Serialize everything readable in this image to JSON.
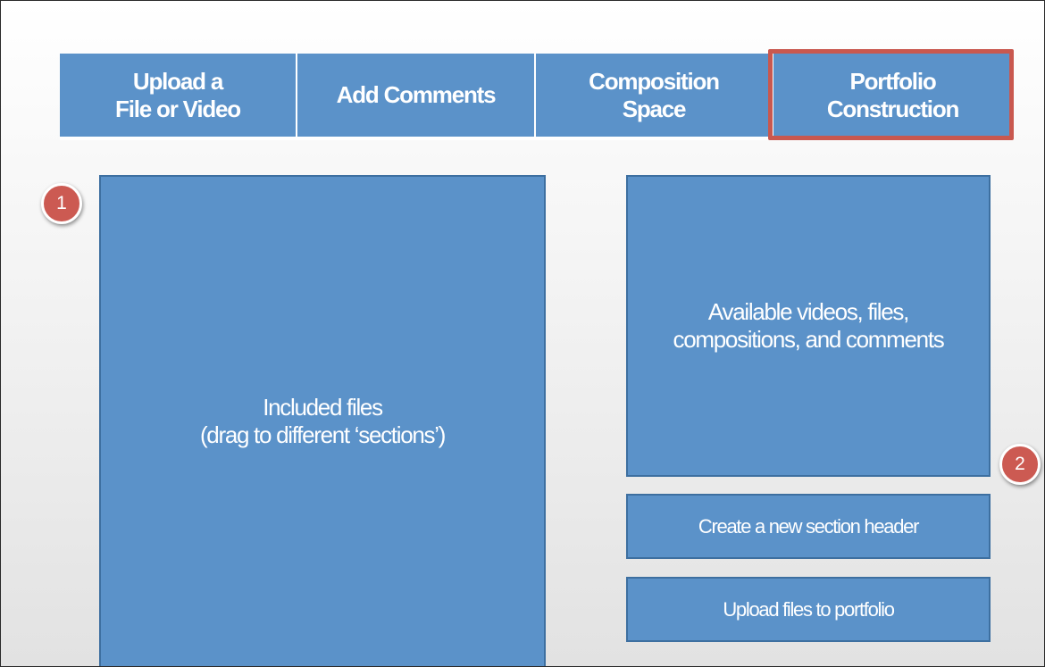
{
  "tabs": [
    {
      "label": "Upload  a\nFile or Video"
    },
    {
      "label": "Add Comments"
    },
    {
      "label": "Composition\nSpace"
    },
    {
      "label": "Portfolio\nConstruction"
    }
  ],
  "panels": {
    "included": "Included files\n(drag to different ‘sections’)",
    "available": "Available videos,  files,\ncompositions, and comments"
  },
  "buttons": {
    "create_section": "Create a new section header",
    "upload_files": "Upload files to portfolio"
  },
  "badges": {
    "one": "1",
    "two": "2"
  },
  "colors": {
    "panel_blue": "#5b92c9",
    "highlight_red": "#c9584f",
    "badge_red": "#cc5a52"
  }
}
